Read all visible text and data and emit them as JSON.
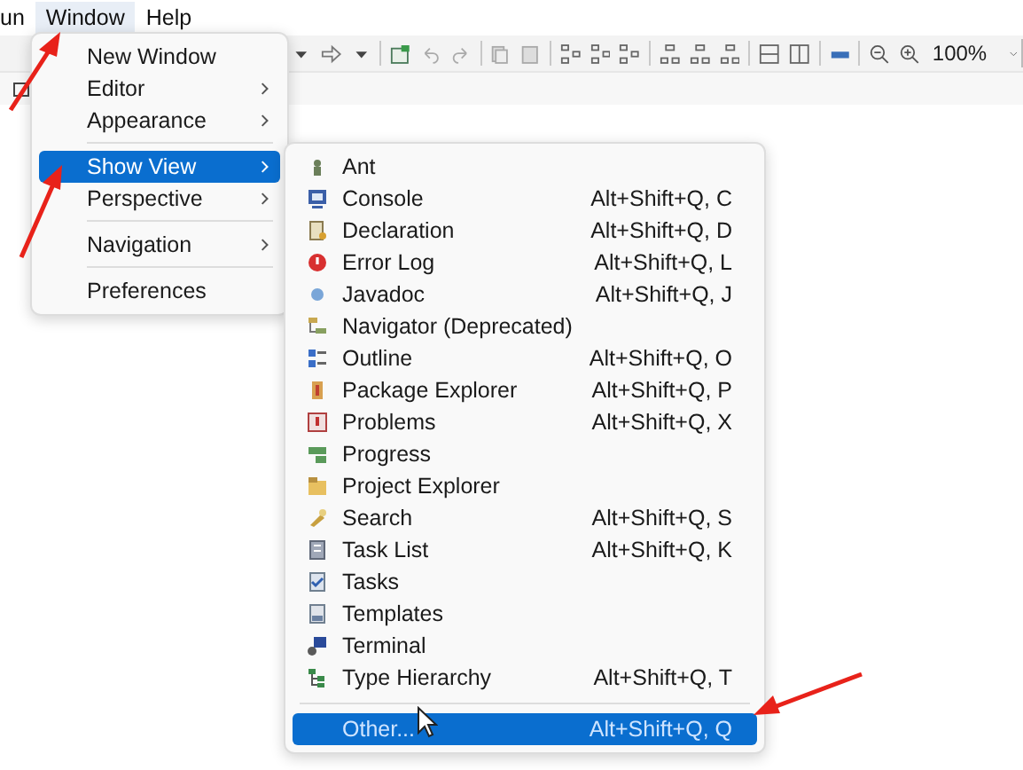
{
  "menubar": [
    {
      "label": "un",
      "selected": false
    },
    {
      "label": "Window",
      "selected": true
    },
    {
      "label": "Help",
      "selected": false
    }
  ],
  "toolbar": {
    "zoom": "100%"
  },
  "window_menu": {
    "items": [
      {
        "kind": "item",
        "label": "New Window",
        "selected": false
      },
      {
        "kind": "submenu",
        "label": "Editor",
        "selected": false
      },
      {
        "kind": "submenu",
        "label": "Appearance",
        "selected": false
      },
      {
        "kind": "separator"
      },
      {
        "kind": "submenu",
        "label": "Show View",
        "selected": true
      },
      {
        "kind": "submenu",
        "label": "Perspective",
        "selected": false
      },
      {
        "kind": "separator"
      },
      {
        "kind": "submenu",
        "label": "Navigation",
        "selected": false
      },
      {
        "kind": "separator"
      },
      {
        "kind": "item",
        "label": "Preferences",
        "selected": false
      }
    ]
  },
  "show_view_menu": {
    "items": [
      {
        "kind": "item",
        "label": "Ant",
        "selected": false
      },
      {
        "kind": "item",
        "label": "Console",
        "shortcut": "Alt+Shift+Q, C",
        "selected": false
      },
      {
        "kind": "item",
        "label": "Declaration",
        "shortcut": "Alt+Shift+Q, D",
        "selected": false
      },
      {
        "kind": "item",
        "label": "Error Log",
        "shortcut": "Alt+Shift+Q, L",
        "selected": false
      },
      {
        "kind": "item",
        "label": "Javadoc",
        "shortcut": "Alt+Shift+Q, J",
        "selected": false
      },
      {
        "kind": "item",
        "label": "Navigator (Deprecated)",
        "selected": false
      },
      {
        "kind": "item",
        "label": "Outline",
        "shortcut": "Alt+Shift+Q, O",
        "selected": false
      },
      {
        "kind": "item",
        "label": "Package Explorer",
        "shortcut": "Alt+Shift+Q, P",
        "selected": false
      },
      {
        "kind": "item",
        "label": "Problems",
        "shortcut": "Alt+Shift+Q, X",
        "selected": false
      },
      {
        "kind": "item",
        "label": "Progress",
        "selected": false
      },
      {
        "kind": "item",
        "label": "Project Explorer",
        "selected": false
      },
      {
        "kind": "item",
        "label": "Search",
        "shortcut": "Alt+Shift+Q, S",
        "selected": false
      },
      {
        "kind": "item",
        "label": "Task List",
        "shortcut": "Alt+Shift+Q, K",
        "selected": false
      },
      {
        "kind": "item",
        "label": "Tasks",
        "selected": false
      },
      {
        "kind": "item",
        "label": "Templates",
        "selected": false
      },
      {
        "kind": "item",
        "label": "Terminal",
        "selected": false
      },
      {
        "kind": "item",
        "label": "Type Hierarchy",
        "shortcut": "Alt+Shift+Q, T",
        "selected": false
      },
      {
        "kind": "separator"
      },
      {
        "kind": "item",
        "label": "Other...",
        "shortcut": "Alt+Shift+Q, Q",
        "selected": true
      }
    ]
  }
}
